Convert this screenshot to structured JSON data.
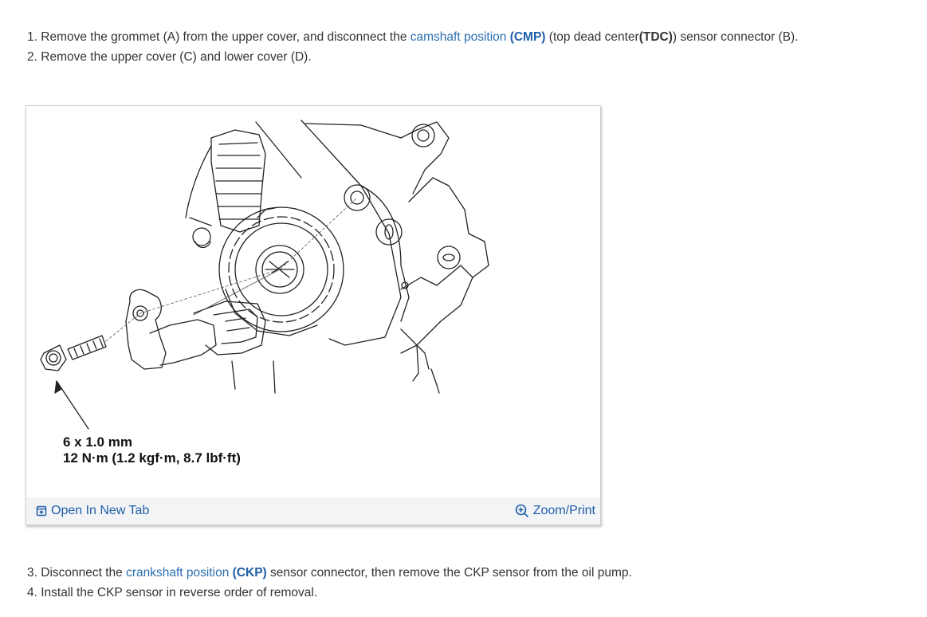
{
  "steps_top": [
    {
      "num": "1.",
      "text_a": "Remove the grommet (A) from the upper cover, and disconnect the",
      "link": "camshaft position",
      "abbr": "(CMP)",
      "text_b": "(top dead center",
      "bold": "(TDC)",
      "text_c": ") sensor connector (B)."
    },
    {
      "num": "2.",
      "text": "Remove the upper cover (C) and lower cover (D)."
    }
  ],
  "figure": {
    "spec_line1": "6 x 1.0 mm",
    "spec_line2": "12 N·m (1.2 kgf·m, 8.7 lbf·ft)",
    "open_tab_label": "Open In New Tab",
    "zoom_label": "Zoom/Print",
    "open_icon": "open-new-tab-icon",
    "zoom_icon": "zoom-plus-icon"
  },
  "steps_bottom": [
    {
      "num": "3.",
      "text_a": "Disconnect the",
      "link": "crankshaft position",
      "abbr": "(CKP)",
      "text_b": "sensor connector, then remove the CKP sensor from the oil pump."
    },
    {
      "num": "4.",
      "text": "Install the CKP sensor in reverse order of removal."
    }
  ],
  "colors": {
    "link": "#2a6fb0",
    "abbr": "#1f5ea8",
    "toolbar_bg": "#f3f4f6"
  }
}
